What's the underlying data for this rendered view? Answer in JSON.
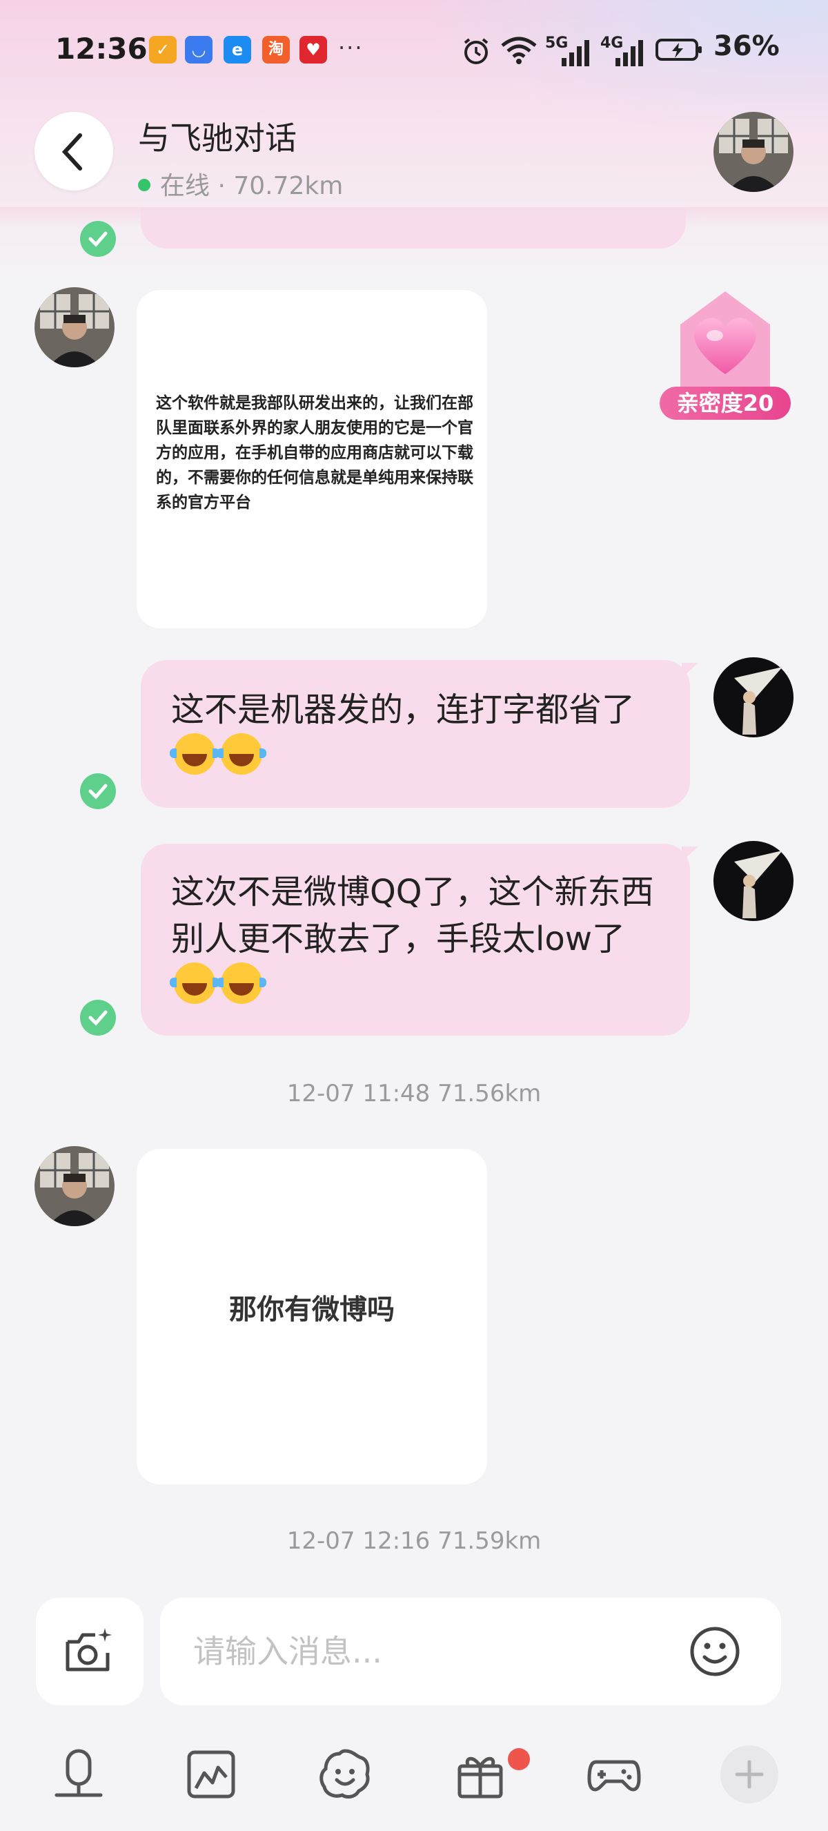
{
  "status_bar": {
    "time": "12:36",
    "apps": [
      {
        "name": "check-app-icon",
        "color": "#f5a623",
        "glyph": "✓"
      },
      {
        "name": "honor-store-icon",
        "color": "#3a7bf0",
        "glyph": "◡"
      },
      {
        "name": "ele-me-icon",
        "color": "#1d8cf2",
        "glyph": "e"
      },
      {
        "name": "taobao-icon",
        "color": "#f25f2a",
        "glyph": "淘"
      },
      {
        "name": "pinduoduo-icon",
        "color": "#e0262f",
        "glyph": "♥"
      }
    ],
    "more": "···",
    "signal_5g": "5G",
    "signal_4g": "4G",
    "battery": "36%"
  },
  "header": {
    "title": "与飞驰对话",
    "online_status": "在线 · 70.72km"
  },
  "intimacy": {
    "label": "亲密度20"
  },
  "messages": {
    "image1_text": "这个软件就是我部队研发出来的，让我们在部队里面联系外界的家人朋友使用的它是一个官方的应用，在手机自带的应用商店就可以下载的，不需要你的任何信息就是单纯用来保持联系的官方平台",
    "sent1_text": "这不是机器发的，连打字都省了",
    "sent2_text": "这次不是微博QQ了，这个新东西别人更不敢去了，手段太low了",
    "timestamp1": "12-07 11:48  71.56km",
    "image2_text": "那你有微博吗",
    "timestamp2": "12-07 12:16  71.59km"
  },
  "input": {
    "placeholder": "请输入消息..."
  },
  "colors": {
    "my_bubble": "#f9dcec",
    "read_check": "#5fd08c",
    "online_dot": "#35c46a",
    "badge_pink": "#e8458e",
    "notify_red": "#f0554b"
  }
}
